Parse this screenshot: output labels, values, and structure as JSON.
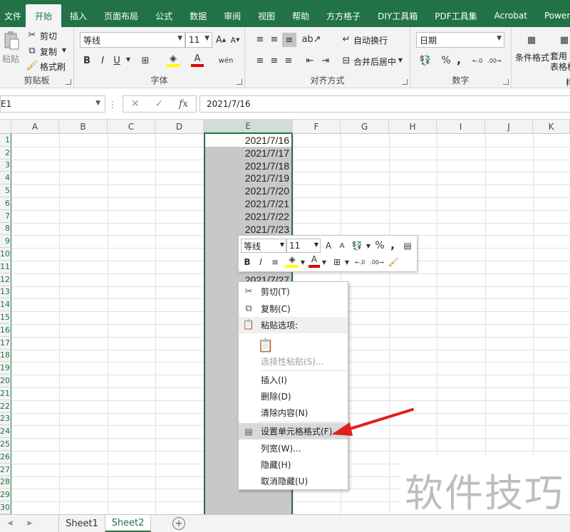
{
  "ribbon": {
    "tabs": [
      "文件",
      "开始",
      "插入",
      "页面布局",
      "公式",
      "数据",
      "审阅",
      "视图",
      "帮助",
      "方方格子",
      "DIY工具箱",
      "PDF工具集",
      "Acrobat",
      "Power P"
    ],
    "active_tab": "开始",
    "clipboard": {
      "paste": "粘贴",
      "cut": "剪切",
      "copy": "复制",
      "format_painter": "格式刷",
      "label": "剪贴板"
    },
    "font": {
      "name": "等线",
      "size": "11",
      "bold": "B",
      "italic": "I",
      "underline": "U",
      "label": "字体"
    },
    "alignment": {
      "wrap_text": "自动换行",
      "merge_center": "合并后居中",
      "label": "对齐方式"
    },
    "number": {
      "format": "日期",
      "percent": "%",
      "comma": ",",
      "label": "数字"
    },
    "styles": {
      "conditional_format": "条件格式",
      "table_format": "套用\n表格格式",
      "partial": "样"
    }
  },
  "formula_bar": {
    "name_box": "E1",
    "cancel": "✕",
    "enter": "✓",
    "fx": "fx",
    "value": "2021/7/16"
  },
  "grid": {
    "columns": [
      "A",
      "B",
      "C",
      "D",
      "E",
      "F",
      "G",
      "H",
      "I",
      "J",
      "K"
    ],
    "selected_column": "E",
    "rows": [
      "1",
      "2",
      "3",
      "4",
      "5",
      "6",
      "7",
      "8",
      "9",
      "10",
      "11",
      "12",
      "13",
      "14",
      "15",
      "16",
      "17",
      "18",
      "19",
      "20",
      "21",
      "22",
      "23",
      "24",
      "25",
      "26",
      "27",
      "28",
      "29",
      "30"
    ],
    "column_e_values": [
      "2021/7/16",
      "2021/7/17",
      "2021/7/18",
      "2021/7/19",
      "2021/7/20",
      "2021/7/21",
      "2021/7/22",
      "2021/7/23",
      "",
      "",
      "",
      "2021/7/27"
    ]
  },
  "mini_toolbar": {
    "font": "等线",
    "size": "11",
    "grow": "A",
    "shrink": "A",
    "percent": "%",
    "comma": ",",
    "bold": "B",
    "italic": "I",
    "font_color": "A"
  },
  "context_menu": {
    "cut": "剪切(T)",
    "copy": "复制(C)",
    "paste_options": "粘贴选项:",
    "paste_special": "选择性粘贴(S)...",
    "insert": "插入(I)",
    "delete": "删除(D)",
    "clear": "清除内容(N)",
    "format_cells": "设置单元格格式(F)...",
    "column_width": "列宽(W)...",
    "hide": "隐藏(H)",
    "unhide": "取消隐藏(U)"
  },
  "sheets": [
    "Sheet1",
    "Sheet2"
  ],
  "active_sheet": "Sheet2",
  "watermark": "软件技巧",
  "colors": {
    "excel_green": "#217346",
    "arrow_red": "#e02020",
    "selection_gray": "#c8c8c8"
  }
}
